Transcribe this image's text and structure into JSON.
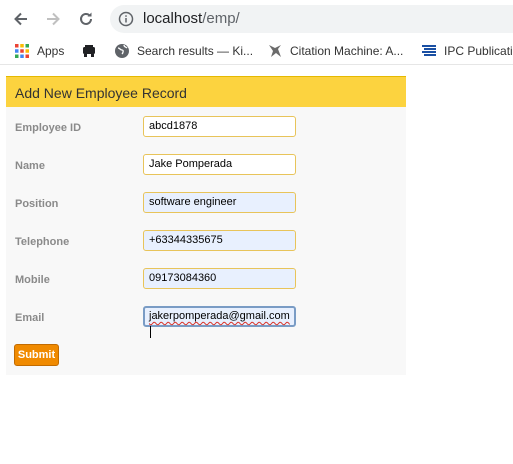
{
  "browser": {
    "url_host": "localhost",
    "url_path": "/emp/",
    "bookmarks": [
      {
        "label": "Apps",
        "icon": "apps-grid-icon"
      },
      {
        "label": "",
        "icon": "bookmark-icon"
      },
      {
        "label": "Search results — Ki...",
        "icon": "globe-icon"
      },
      {
        "label": "Citation Machine: A...",
        "icon": "citation-machine-icon"
      },
      {
        "label": "IPC Publicatio",
        "icon": "ipc-icon"
      }
    ]
  },
  "form": {
    "title": "Add New Employee Record",
    "fields": [
      {
        "label": "Employee ID",
        "value": "abcd1878"
      },
      {
        "label": "Name",
        "value": "Jake Pomperada"
      },
      {
        "label": "Position",
        "value": "software engineer"
      },
      {
        "label": "Telephone",
        "value": "+63344335675"
      },
      {
        "label": "Mobile",
        "value": "09173084360"
      },
      {
        "label": "Email",
        "value": "jakerpomperada@gmail.com"
      }
    ],
    "submit_label": "Submit"
  },
  "colors": {
    "header_bg": "#fcd33f",
    "submit_bg": "#f08a00",
    "panel_bg": "#f8f8f8",
    "autofill_bg": "#e8f0fe"
  }
}
